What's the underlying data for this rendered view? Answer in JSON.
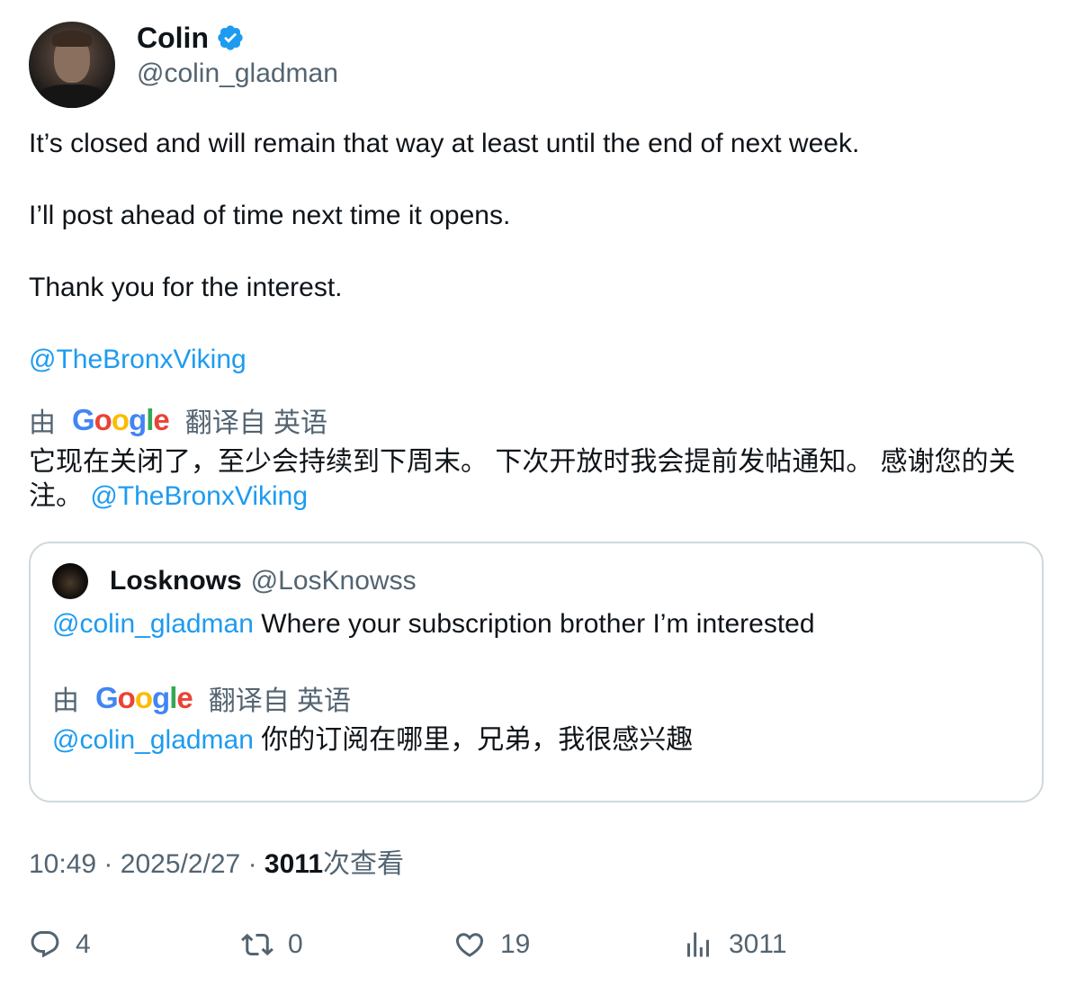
{
  "author": {
    "display_name": "Colin",
    "handle": "@colin_gladman"
  },
  "tweet": {
    "paragraphs": [
      "It’s closed and will remain that way at least until the end of next week.",
      "I’ll post ahead of time next time it opens.",
      "Thank you for the interest."
    ],
    "mention": "@TheBronxViking"
  },
  "translation": {
    "prefix": "由",
    "logo": "Google",
    "suffix": "翻译自 英语",
    "text": "它现在关闭了，至少会持续到下周末。 下次开放时我会提前发帖通知。 感谢您的关注。",
    "mention": "@TheBronxViking"
  },
  "quote": {
    "display_name": "Losknows",
    "handle": "@LosKnowss",
    "mention": "@colin_gladman",
    "text": "Where your subscription brother I’m interested",
    "translation": {
      "prefix": "由",
      "logo": "Google",
      "suffix": "翻译自 英语",
      "mention": "@colin_gladman",
      "text": "你的订阅在哪里，兄弟，我很感兴趣"
    }
  },
  "meta": {
    "time": "10:49",
    "separator": "·",
    "date": "2025/2/27",
    "views_count": "3011",
    "views_label": "次查看"
  },
  "actions": {
    "replies": "4",
    "retweets": "0",
    "likes": "19",
    "views": "3011"
  },
  "colors": {
    "link": "#1d9bf0",
    "secondary_text": "#536471",
    "primary_text": "#0f1419",
    "border": "#cfd9de"
  }
}
